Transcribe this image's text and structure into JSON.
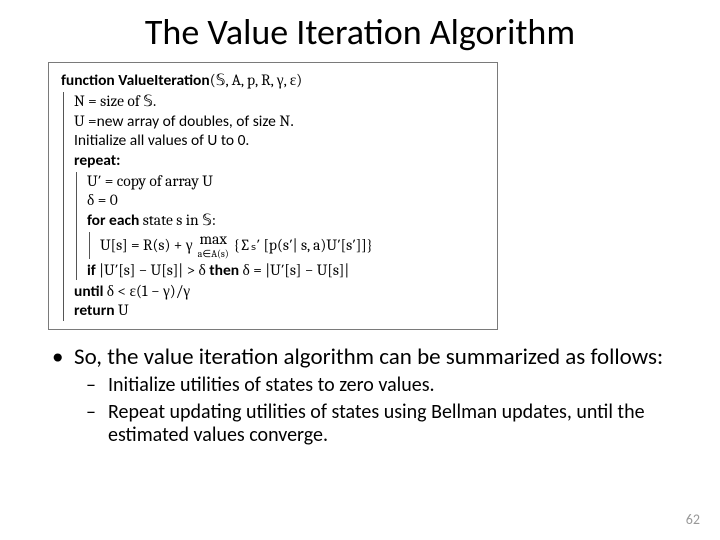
{
  "title": "The Value Iteration Algorithm",
  "algo": {
    "func_kw": "function",
    "func_name": "ValueIteration",
    "func_args": "(𝕊, A, p, R, γ, ε)",
    "l1": "N = size of 𝕊.",
    "l2": "U =new array of doubles, of size N.",
    "l3": "Initialize all values of U to 0.",
    "repeat": "repeat:",
    "r1": "U′ = copy of array U",
    "r2": "δ = 0",
    "for_kw": "for each",
    "for_rest": " state  s  in 𝕊:",
    "eq_lhs": "U[s] = R(s) + γ",
    "eq_max": "max",
    "eq_max_sub": "a∈A(s)",
    "eq_rhs": "{∑ₛ′ [p(s′| s, a)U′[s′]]}",
    "if_kw": "if",
    "if_cond": " |U′[s] − U[s]| > δ ",
    "then_kw": "then",
    "then_body": " δ = |U′[s] − U[s]|",
    "until_kw": "until",
    "until_cond": " δ < ε(1 − γ)/γ",
    "return_kw": "return",
    "return_val": " U"
  },
  "bullets": {
    "b1": "So, the value iteration algorithm can be summarized as follows:",
    "b2a": "Initialize utilities of states to zero values.",
    "b2b": "Repeat updating utilities of states using Bellman updates, until the estimated values converge."
  },
  "page_number": "62"
}
